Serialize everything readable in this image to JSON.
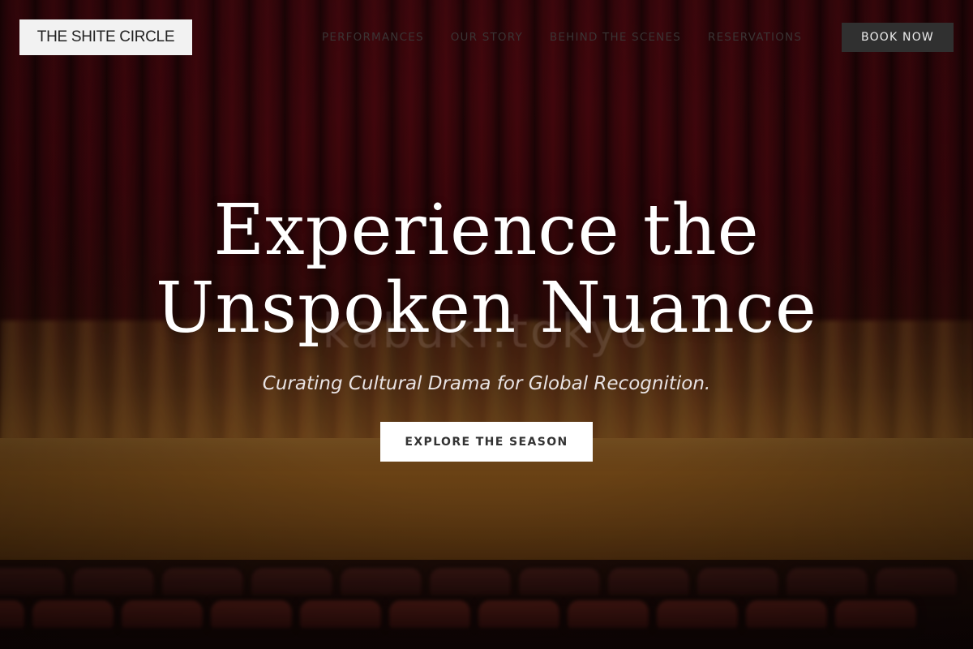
{
  "brand": {
    "logo_text": "THE SHITE CIRCLE"
  },
  "nav": {
    "items": [
      {
        "label": "PERFORMANCES"
      },
      {
        "label": "OUR STORY"
      },
      {
        "label": "BEHIND THE SCENES"
      },
      {
        "label": "RESERVATIONS"
      }
    ],
    "cta_label": "BOOK NOW"
  },
  "hero": {
    "headline_line1": "Experience the",
    "headline_line2": "Unspoken Nuance",
    "tagline": "Curating Cultural Drama for Global Recognition.",
    "cta_label": "EXPLORE THE SEASON",
    "background_watermark": "kabuki.tokyo"
  },
  "colors": {
    "curtain": "#4a070e",
    "stage": "#7d5019",
    "book_button": "#303030",
    "logo_background": "#f2f2f2",
    "headline": "#ffffff"
  }
}
